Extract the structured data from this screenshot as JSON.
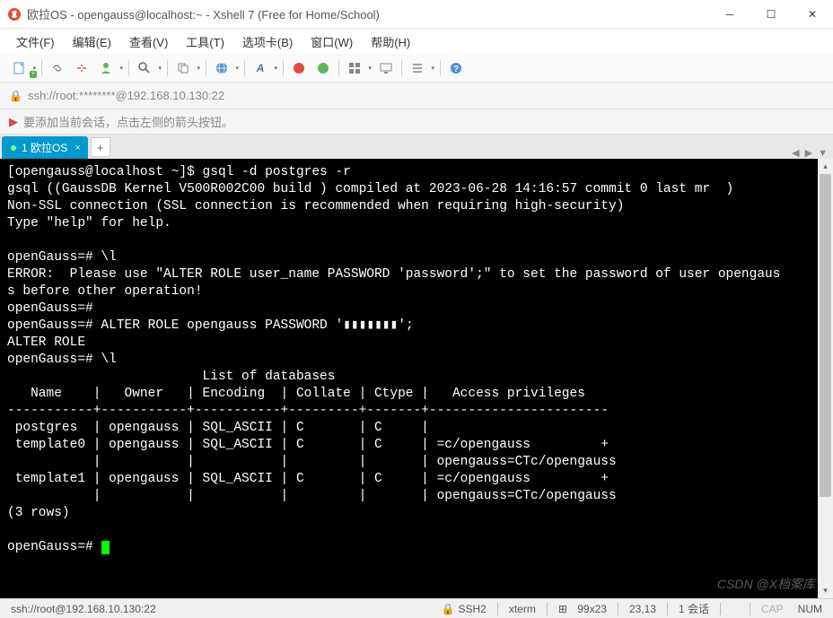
{
  "window": {
    "title": "欧拉OS - opengauss@localhost:~ - Xshell 7 (Free for Home/School)"
  },
  "menu": {
    "items": [
      "文件(F)",
      "编辑(E)",
      "查看(V)",
      "工具(T)",
      "选项卡(B)",
      "窗口(W)",
      "帮助(H)"
    ]
  },
  "address": "ssh://root:********@192.168.10.130:22",
  "hint": "要添加当前会话，点击左侧的箭头按钮。",
  "tab": {
    "label": "1 欧拉OS"
  },
  "terminal_lines": [
    "[opengauss@localhost ~]$ gsql -d postgres -r",
    "gsql ((GaussDB Kernel V500R002C00 build ) compiled at 2023-06-28 14:16:57 commit 0 last mr  )",
    "Non-SSL connection (SSL connection is recommended when requiring high-security)",
    "Type \"help\" for help.",
    "",
    "openGauss=# \\l",
    "ERROR:  Please use \"ALTER ROLE user_name PASSWORD 'password';\" to set the password of user opengaus",
    "s before other operation!",
    "openGauss=#",
    "openGauss=# ALTER ROLE opengauss PASSWORD '▮▮▮▮▮▮▮';",
    "ALTER ROLE",
    "openGauss=# \\l",
    "                         List of databases",
    "   Name    |   Owner   | Encoding  | Collate | Ctype |   Access privileges   ",
    "-----------+-----------+-----------+---------+-------+-----------------------",
    " postgres  | opengauss | SQL_ASCII | C       | C     | ",
    " template0 | opengauss | SQL_ASCII | C       | C     | =c/opengauss         +",
    "           |           |           |         |       | opengauss=CTc/opengauss",
    " template1 | opengauss | SQL_ASCII | C       | C     | =c/opengauss         +",
    "           |           |           |         |       | opengauss=CTc/opengauss",
    "(3 rows)",
    "",
    "openGauss=# "
  ],
  "status": {
    "conn": "ssh://root@192.168.10.130:22",
    "proto": "SSH2",
    "term": "xterm",
    "size": "99x23",
    "pos": "23,13",
    "sessions": "1 会话",
    "caps": "CAP",
    "num": "NUM"
  },
  "watermark": "CSDN @X档案库"
}
